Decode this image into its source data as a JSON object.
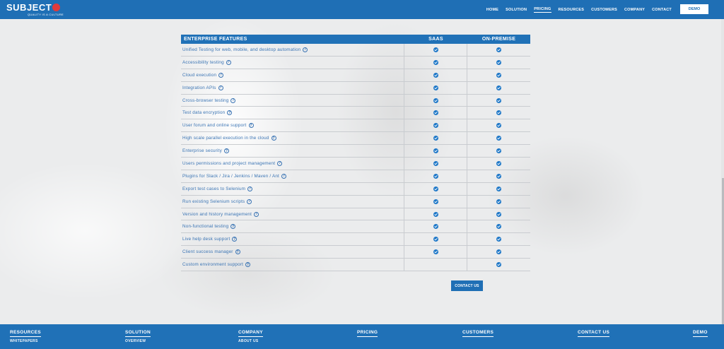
{
  "header": {
    "logo_text": "SUBJECT",
    "logo_tagline": "QUALITY IS A CULTURE",
    "nav": [
      "HOME",
      "SOLUTION",
      "PRICING",
      "RESOURCES",
      "CUSTOMERS",
      "COMPANY",
      "CONTACT"
    ],
    "active_nav": "PRICING",
    "demo_label": "DEMO"
  },
  "table": {
    "headers": [
      "ENTERPRISE FEATURES",
      "SAAS",
      "ON-PREMISE"
    ],
    "rows": [
      {
        "feature": "Unified Testing for web, mobile, and desktop automation",
        "saas": true,
        "onprem": true
      },
      {
        "feature": "Accessibility testing",
        "saas": true,
        "onprem": true
      },
      {
        "feature": "Cloud execution",
        "saas": true,
        "onprem": true
      },
      {
        "feature": "Integration APIs",
        "saas": true,
        "onprem": true
      },
      {
        "feature": "Cross-browser testing",
        "saas": true,
        "onprem": true
      },
      {
        "feature": "Test data encryption",
        "saas": true,
        "onprem": true
      },
      {
        "feature": "User forum and online support",
        "saas": true,
        "onprem": true
      },
      {
        "feature": "High scale parallel execution in the cloud",
        "saas": true,
        "onprem": true
      },
      {
        "feature": "Enterprise security",
        "saas": true,
        "onprem": true
      },
      {
        "feature": "Users permissions and project management",
        "saas": true,
        "onprem": true
      },
      {
        "feature": "Plugins for Slack / Jira / Jenkins / Maven / Ant",
        "saas": true,
        "onprem": true
      },
      {
        "feature": "Export test cases to Selenium",
        "saas": true,
        "onprem": true
      },
      {
        "feature": "Run existing Selenium scripts",
        "saas": true,
        "onprem": true
      },
      {
        "feature": "Version and history management",
        "saas": true,
        "onprem": true
      },
      {
        "feature": "Non-functional testing",
        "saas": true,
        "onprem": true
      },
      {
        "feature": "Live help desk support",
        "saas": true,
        "onprem": true
      },
      {
        "feature": "Client success manager",
        "saas": true,
        "onprem": true
      },
      {
        "feature": "Custom environment support",
        "saas": false,
        "onprem": true
      }
    ],
    "help_icon": "question-circle-icon",
    "check_icon": "check-circle-icon"
  },
  "contact_button": "CONTACT US",
  "footer": {
    "columns": [
      {
        "title": "RESOURCES",
        "sub": "WHITEPAPERS"
      },
      {
        "title": "SOLUTION",
        "sub": "OVERVIEW"
      },
      {
        "title": "COMPANY",
        "sub": "ABOUT US"
      },
      {
        "title": "PRICING",
        "sub": ""
      },
      {
        "title": "CUSTOMERS",
        "sub": ""
      },
      {
        "title": "CONTACT US",
        "sub": ""
      },
      {
        "title": "DEMO",
        "sub": ""
      }
    ]
  },
  "colors": {
    "brand_blue": "#1f6fb5",
    "check_blue": "#1f78c8",
    "logo_red": "#e23a3a"
  }
}
